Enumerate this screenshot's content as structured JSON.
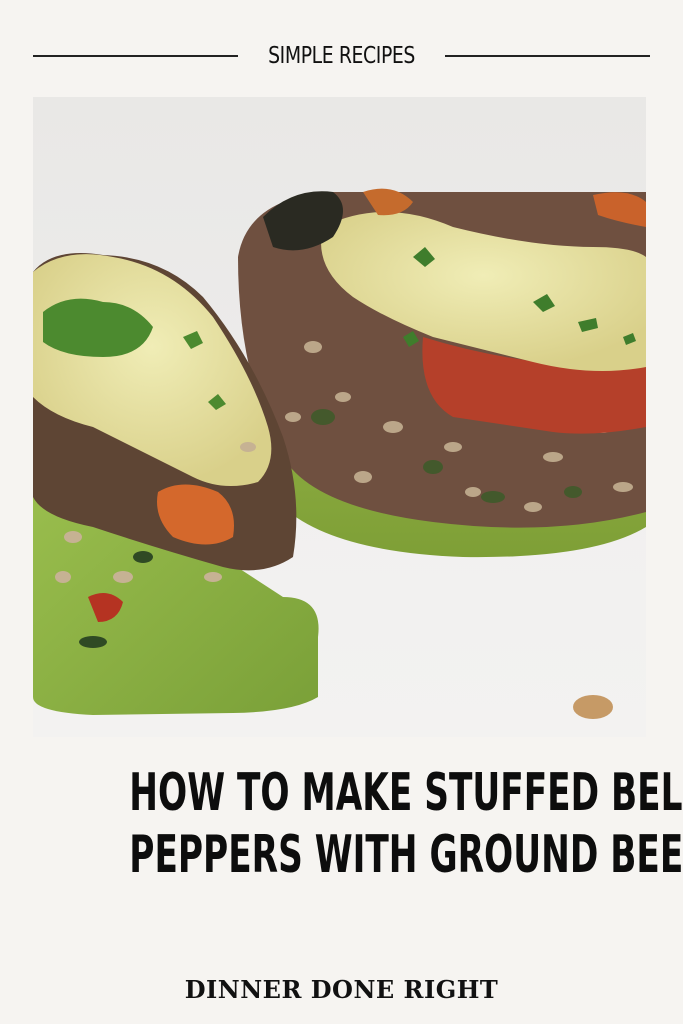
{
  "header": {
    "kicker": "SIMPLE RECIPES"
  },
  "title": {
    "line1": "HOW TO MAKE STUFFED BELL",
    "line2": "PEPPERS WITH GROUND BEEF"
  },
  "brand": {
    "name": "DINNER DONE RIGHT"
  },
  "colors": {
    "background": "#f6f4f1",
    "text": "#0d0d0d",
    "pepper_green": "#8fb447"
  }
}
